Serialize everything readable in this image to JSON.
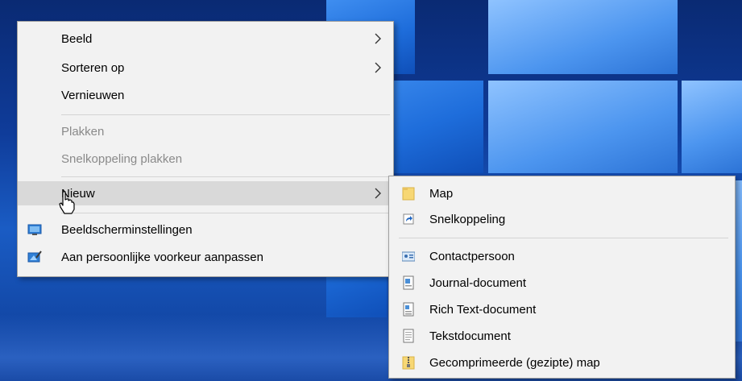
{
  "context_menu": {
    "items": [
      {
        "label": "Beeld"
      },
      {
        "label": "Sorteren op"
      },
      {
        "label": "Vernieuwen"
      },
      {
        "label": "Plakken"
      },
      {
        "label": "Snelkoppeling plakken"
      },
      {
        "label": "Nieuw"
      },
      {
        "label": "Beeldscherminstellingen"
      },
      {
        "label": "Aan persoonlijke voorkeur aanpassen"
      }
    ]
  },
  "submenu": {
    "items": [
      {
        "label": "Map"
      },
      {
        "label": "Snelkoppeling"
      },
      {
        "label": "Contactpersoon"
      },
      {
        "label": "Journal-document"
      },
      {
        "label": "Rich Text-document"
      },
      {
        "label": "Tekstdocument"
      },
      {
        "label": "Gecomprimeerde (gezipte) map"
      }
    ]
  },
  "colors": {
    "menu_background": "#f2f2f2",
    "highlight": "#d9d9d9",
    "disabled_text": "#8a8a8a",
    "desktop_blue": "#0f3c9a"
  },
  "icons": {
    "display_settings": "monitor-icon",
    "personalize": "personalize-icon",
    "folder": "folder-icon",
    "shortcut": "shortcut-icon",
    "contact": "contact-card-icon",
    "journal": "journal-document-icon",
    "rich_text": "rich-text-document-icon",
    "text": "text-document-icon",
    "zip": "zip-folder-icon"
  }
}
